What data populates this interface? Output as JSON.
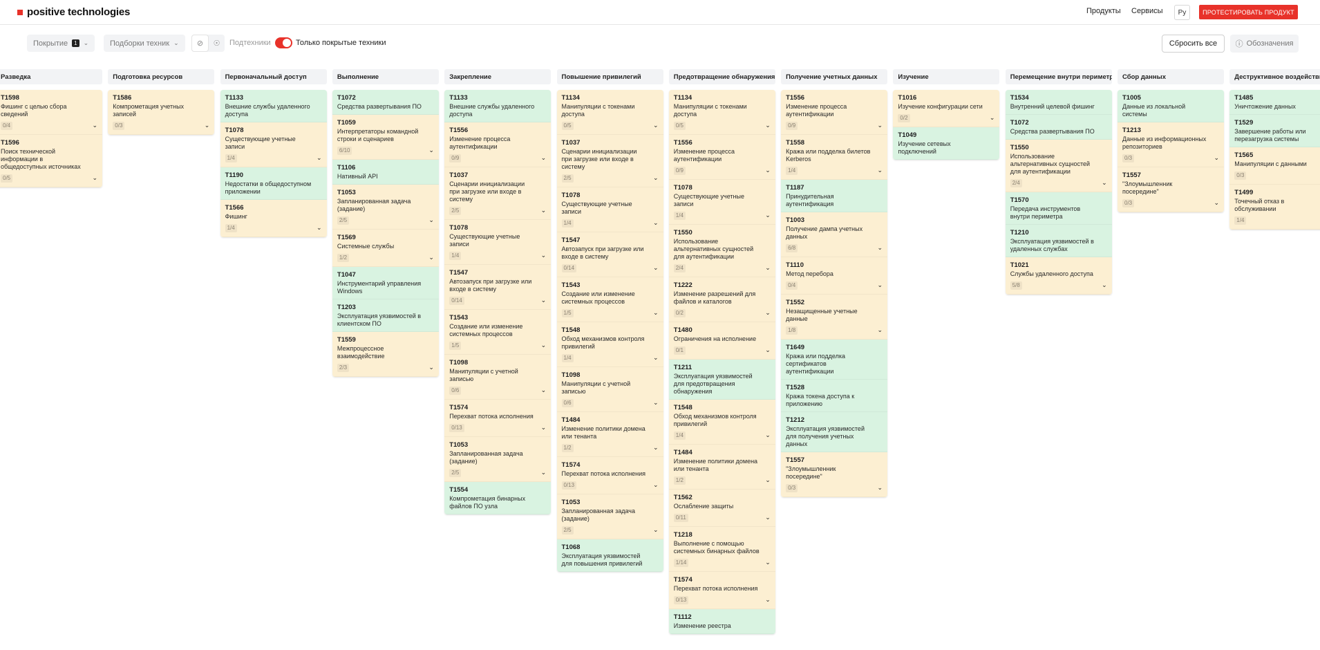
{
  "header": {
    "logo_text": "positive technologies",
    "nav": [
      "Продукты",
      "Сервисы"
    ],
    "lang": "Ру",
    "cta": "ПРОТЕСТИРОВАТЬ ПРОДУКТ"
  },
  "toolbar": {
    "coverage_label": "Покрытие",
    "coverage_badge": "1",
    "selections_label": "Подборки техник",
    "subtechniques_label": "Подтехники",
    "only_covered_label": "Только покрытые техники",
    "reset_label": "Сбросить все",
    "legend_label": "Обозначения"
  },
  "colors": {
    "accent": "#e8322a",
    "covered": "#d9f3e1",
    "partial": "#fcefd2"
  },
  "columns": [
    {
      "title": "Разведка",
      "cards": [
        {
          "id": "T1598",
          "name": "Фишинг с целью сбора сведений",
          "count": "0/4",
          "status": "y",
          "expand": true
        },
        {
          "id": "T1596",
          "name": "Поиск технической информации в общедоступных источниках",
          "count": "0/5",
          "status": "y",
          "expand": true
        }
      ]
    },
    {
      "title": "Подготовка ресурсов",
      "cards": [
        {
          "id": "T1586",
          "name": "Компрометация учетных записей",
          "count": "0/3",
          "status": "y",
          "expand": true
        }
      ]
    },
    {
      "title": "Первоначальный доступ",
      "cards": [
        {
          "id": "T1133",
          "name": "Внешние службы удаленного доступа",
          "count": "",
          "status": "g",
          "expand": false
        },
        {
          "id": "T1078",
          "name": "Существующие учетные записи",
          "count": "1/4",
          "status": "y",
          "expand": true
        },
        {
          "id": "T1190",
          "name": "Недостатки в общедоступном приложении",
          "count": "",
          "status": "g",
          "expand": false
        },
        {
          "id": "T1566",
          "name": "Фишинг",
          "count": "1/4",
          "status": "y",
          "expand": true
        }
      ]
    },
    {
      "title": "Выполнение",
      "cards": [
        {
          "id": "T1072",
          "name": "Средства развертывания ПО",
          "count": "",
          "status": "g",
          "expand": false
        },
        {
          "id": "T1059",
          "name": "Интерпретаторы командной строки и сценариев",
          "count": "6/10",
          "status": "y",
          "expand": true
        },
        {
          "id": "T1106",
          "name": "Нативный API",
          "count": "",
          "status": "g",
          "expand": false
        },
        {
          "id": "T1053",
          "name": "Запланированная задача (задание)",
          "count": "2/5",
          "status": "y",
          "expand": true
        },
        {
          "id": "T1569",
          "name": "Системные службы",
          "count": "1/2",
          "status": "y",
          "expand": true
        },
        {
          "id": "T1047",
          "name": "Инструментарий управления Windows",
          "count": "",
          "status": "g",
          "expand": false
        },
        {
          "id": "T1203",
          "name": "Эксплуатация уязвимостей в клиентском ПО",
          "count": "",
          "status": "g",
          "expand": false
        },
        {
          "id": "T1559",
          "name": "Межпроцессное взаимодействие",
          "count": "2/3",
          "status": "y",
          "expand": true
        }
      ]
    },
    {
      "title": "Закрепление",
      "cards": [
        {
          "id": "T1133",
          "name": "Внешние службы удаленного доступа",
          "count": "",
          "status": "g",
          "expand": false
        },
        {
          "id": "T1556",
          "name": "Изменение процесса аутентификации",
          "count": "0/9",
          "status": "y",
          "expand": true
        },
        {
          "id": "T1037",
          "name": "Сценарии инициализации при загрузке или входе в систему",
          "count": "2/5",
          "status": "y",
          "expand": true
        },
        {
          "id": "T1078",
          "name": "Существующие учетные записи",
          "count": "1/4",
          "status": "y",
          "expand": true
        },
        {
          "id": "T1547",
          "name": "Автозапуск при загрузке или входе в систему",
          "count": "0/14",
          "status": "y",
          "expand": true
        },
        {
          "id": "T1543",
          "name": "Создание или изменение системных процессов",
          "count": "1/5",
          "status": "y",
          "expand": true
        },
        {
          "id": "T1098",
          "name": "Манипуляции с учетной записью",
          "count": "0/6",
          "status": "y",
          "expand": true
        },
        {
          "id": "T1574",
          "name": "Перехват потока исполнения",
          "count": "0/13",
          "status": "y",
          "expand": true
        },
        {
          "id": "T1053",
          "name": "Запланированная задача (задание)",
          "count": "2/5",
          "status": "y",
          "expand": true
        },
        {
          "id": "T1554",
          "name": "Компрометация бинарных файлов ПО узла",
          "count": "",
          "status": "g",
          "expand": false
        }
      ]
    },
    {
      "title": "Повышение привилегий",
      "cards": [
        {
          "id": "T1134",
          "name": "Манипуляции с токенами доступа",
          "count": "0/5",
          "status": "y",
          "expand": true
        },
        {
          "id": "T1037",
          "name": "Сценарии инициализации при загрузке или входе в систему",
          "count": "2/5",
          "status": "y",
          "expand": true
        },
        {
          "id": "T1078",
          "name": "Существующие учетные записи",
          "count": "1/4",
          "status": "y",
          "expand": true
        },
        {
          "id": "T1547",
          "name": "Автозапуск при загрузке или входе в систему",
          "count": "0/14",
          "status": "y",
          "expand": true
        },
        {
          "id": "T1543",
          "name": "Создание или изменение системных процессов",
          "count": "1/5",
          "status": "y",
          "expand": true
        },
        {
          "id": "T1548",
          "name": "Обход механизмов контроля привилегий",
          "count": "1/4",
          "status": "y",
          "expand": true
        },
        {
          "id": "T1098",
          "name": "Манипуляции с учетной записью",
          "count": "0/6",
          "status": "y",
          "expand": true
        },
        {
          "id": "T1484",
          "name": "Изменение политики домена или тенанта",
          "count": "1/2",
          "status": "y",
          "expand": true
        },
        {
          "id": "T1574",
          "name": "Перехват потока исполнения",
          "count": "0/13",
          "status": "y",
          "expand": true
        },
        {
          "id": "T1053",
          "name": "Запланированная задача (задание)",
          "count": "2/5",
          "status": "y",
          "expand": true
        },
        {
          "id": "T1068",
          "name": "Эксплуатация уязвимостей для повышения привилегий",
          "count": "",
          "status": "g",
          "expand": false
        }
      ]
    },
    {
      "title": "Предотвращение обнаружения",
      "cards": [
        {
          "id": "T1134",
          "name": "Манипуляции с токенами доступа",
          "count": "0/5",
          "status": "y",
          "expand": true
        },
        {
          "id": "T1556",
          "name": "Изменение процесса аутентификации",
          "count": "0/9",
          "status": "y",
          "expand": true
        },
        {
          "id": "T1078",
          "name": "Существующие учетные записи",
          "count": "1/4",
          "status": "y",
          "expand": true
        },
        {
          "id": "T1550",
          "name": "Использование альтернативных сущностей для аутентификации",
          "count": "2/4",
          "status": "y",
          "expand": true
        },
        {
          "id": "T1222",
          "name": "Изменение разрешений для файлов и каталогов",
          "count": "0/2",
          "status": "y",
          "expand": true
        },
        {
          "id": "T1480",
          "name": "Ограничения на исполнение",
          "count": "0/1",
          "status": "y",
          "expand": true
        },
        {
          "id": "T1211",
          "name": "Эксплуатация уязвимостей для предотвращения обнаружения",
          "count": "",
          "status": "g",
          "expand": false
        },
        {
          "id": "T1548",
          "name": "Обход механизмов контроля привилегий",
          "count": "1/4",
          "status": "y",
          "expand": true
        },
        {
          "id": "T1484",
          "name": "Изменение политики домена или тенанта",
          "count": "1/2",
          "status": "y",
          "expand": true
        },
        {
          "id": "T1562",
          "name": "Ослабление защиты",
          "count": "0/11",
          "status": "y",
          "expand": true
        },
        {
          "id": "T1218",
          "name": "Выполнение с помощью системных бинарных файлов",
          "count": "1/14",
          "status": "y",
          "expand": true
        },
        {
          "id": "T1574",
          "name": "Перехват потока исполнения",
          "count": "0/13",
          "status": "y",
          "expand": true
        },
        {
          "id": "T1112",
          "name": "Изменение реестра",
          "count": "",
          "status": "g",
          "expand": false
        }
      ]
    },
    {
      "title": "Получение учетных данных",
      "cards": [
        {
          "id": "T1556",
          "name": "Изменение процесса аутентификации",
          "count": "0/9",
          "status": "y",
          "expand": true
        },
        {
          "id": "T1558",
          "name": "Кража или подделка билетов Kerberos",
          "count": "1/4",
          "status": "y",
          "expand": true
        },
        {
          "id": "T1187",
          "name": "Принудительная аутентификация",
          "count": "",
          "status": "g",
          "expand": false
        },
        {
          "id": "T1003",
          "name": "Получение дампа учетных данных",
          "count": "6/8",
          "status": "y",
          "expand": true
        },
        {
          "id": "T1110",
          "name": "Метод перебора",
          "count": "0/4",
          "status": "y",
          "expand": true
        },
        {
          "id": "T1552",
          "name": "Незащищенные учетные данные",
          "count": "1/8",
          "status": "y",
          "expand": true
        },
        {
          "id": "T1649",
          "name": "Кража или подделка сертификатов аутентификации",
          "count": "",
          "status": "g",
          "expand": false
        },
        {
          "id": "T1528",
          "name": "Кража токена доступа к приложению",
          "count": "",
          "status": "g",
          "expand": false
        },
        {
          "id": "T1212",
          "name": "Эксплуатация уязвимостей для получения учетных данных",
          "count": "",
          "status": "g",
          "expand": false
        },
        {
          "id": "T1557",
          "name": "\"Злоумышленник посередине\"",
          "count": "0/3",
          "status": "y",
          "expand": true
        }
      ]
    },
    {
      "title": "Изучение",
      "cards": [
        {
          "id": "T1016",
          "name": "Изучение конфигурации сети",
          "count": "0/2",
          "status": "y",
          "expand": true
        },
        {
          "id": "T1049",
          "name": "Изучение сетевых подключений",
          "count": "",
          "status": "g",
          "expand": false
        }
      ]
    },
    {
      "title": "Перемещение внутри периметра",
      "cards": [
        {
          "id": "T1534",
          "name": "Внутренний целевой фишинг",
          "count": "",
          "status": "g",
          "expand": false
        },
        {
          "id": "T1072",
          "name": "Средства развертывания ПО",
          "count": "",
          "status": "g",
          "expand": false
        },
        {
          "id": "T1550",
          "name": "Использование альтернативных сущностей для аутентификации",
          "count": "2/4",
          "status": "y",
          "expand": true
        },
        {
          "id": "T1570",
          "name": "Передача инструментов внутри периметра",
          "count": "",
          "status": "g",
          "expand": false
        },
        {
          "id": "T1210",
          "name": "Эксплуатация уязвимостей в удаленных службах",
          "count": "",
          "status": "g",
          "expand": false
        },
        {
          "id": "T1021",
          "name": "Службы удаленного доступа",
          "count": "5/8",
          "status": "y",
          "expand": true
        }
      ]
    },
    {
      "title": "Сбор данных",
      "cards": [
        {
          "id": "T1005",
          "name": "Данные из локальной системы",
          "count": "",
          "status": "g",
          "expand": false
        },
        {
          "id": "T1213",
          "name": "Данные из информационных репозиториев",
          "count": "0/3",
          "status": "y",
          "expand": true
        },
        {
          "id": "T1557",
          "name": "\"Злоумышленник посередине\"",
          "count": "0/3",
          "status": "y",
          "expand": true
        }
      ]
    },
    {
      "title": "Деструктивное воздействие",
      "cards": [
        {
          "id": "T1485",
          "name": "Уничтожение данных",
          "count": "",
          "status": "g",
          "expand": false
        },
        {
          "id": "T1529",
          "name": "Завершение работы или перезагрузка системы",
          "count": "",
          "status": "g",
          "expand": false
        },
        {
          "id": "T1565",
          "name": "Манипуляции с данными",
          "count": "0/3",
          "status": "y",
          "expand": true
        },
        {
          "id": "T1499",
          "name": "Точечный отказ в обслуживании",
          "count": "1/4",
          "status": "y",
          "expand": true
        }
      ]
    }
  ]
}
